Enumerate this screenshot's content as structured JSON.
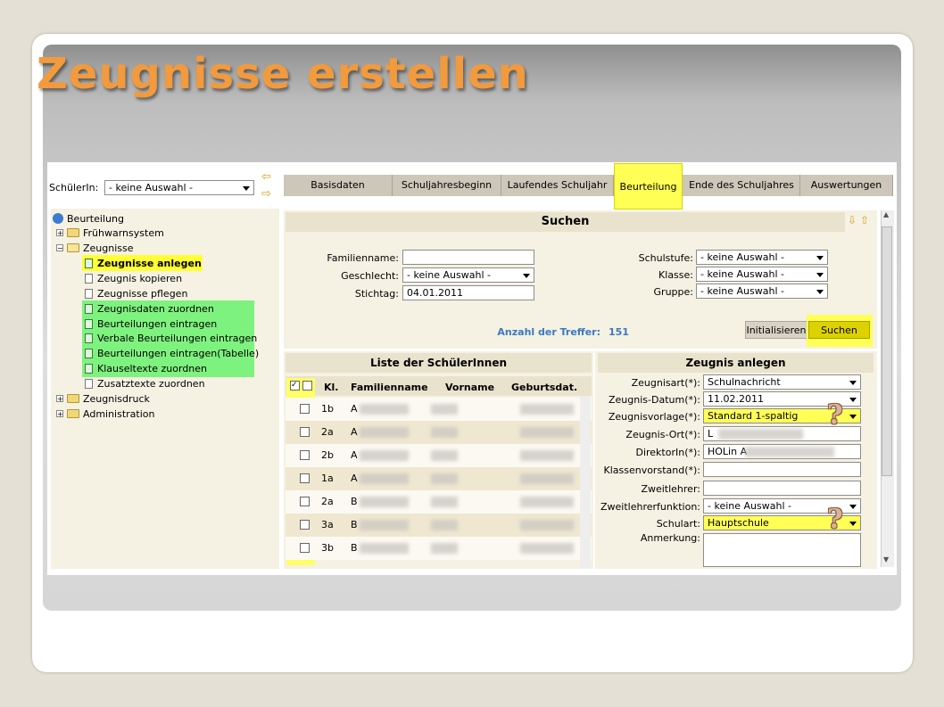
{
  "slide_title": "Zeugnisse erstellen",
  "student_select": {
    "label": "SchülerIn:",
    "value": "- keine Auswahl -"
  },
  "tabs": [
    "Basisdaten",
    "Schuljahresbeginn",
    "Laufendes Schuljahr",
    "Beurteilung",
    "Ende des Schuljahres",
    "Auswertungen"
  ],
  "active_tab": "Beurteilung",
  "tree": {
    "root": "Beurteilung",
    "nodes": [
      "Frühwarnsystem",
      "Zeugnisse",
      "Zeugnisdruck",
      "Administration"
    ],
    "zeugnisse_children": [
      "Zeugnisse anlegen",
      "Zeugnis kopieren",
      "Zeugnisse pflegen",
      "Zeugnisdaten zuordnen",
      "Beurteilungen eintragen",
      "Verbale Beurteilungen eintragen",
      "Beurteilungen eintragen(Tabelle)",
      "Klauseltexte zuordnen",
      "Zusatztexte zuordnen"
    ]
  },
  "search": {
    "header": "Suchen",
    "familienname_label": "Familienname:",
    "familienname_value": "",
    "geschlecht_label": "Geschlecht:",
    "geschlecht_value": "- keine Auswahl -",
    "stichtag_label": "Stichtag:",
    "stichtag_value": "04.01.2011",
    "schulstufe_label": "Schulstufe:",
    "schulstufe_value": "- keine Auswahl -",
    "klasse_label": "Klasse:",
    "klasse_value": "- keine Auswahl -",
    "gruppe_label": "Gruppe:",
    "gruppe_value": "- keine Auswahl -",
    "treffer_label": "Anzahl der Treffer:",
    "treffer_value": "151",
    "init_button": "Initialisieren",
    "search_button": "Suchen"
  },
  "student_list": {
    "header": "Liste der SchülerInnen",
    "columns": [
      "Kl.",
      "Familienname",
      "Vorname",
      "Geburtsdat."
    ],
    "rows": [
      {
        "kl": "1b",
        "initial": "A"
      },
      {
        "kl": "2a",
        "initial": "A"
      },
      {
        "kl": "2b",
        "initial": "A"
      },
      {
        "kl": "1a",
        "initial": "A"
      },
      {
        "kl": "2a",
        "initial": "B"
      },
      {
        "kl": "3a",
        "initial": "B"
      },
      {
        "kl": "3b",
        "initial": "B"
      }
    ]
  },
  "zeugnis": {
    "header": "Zeugnis anlegen",
    "zeugnisart_label": "Zeugnisart(*):",
    "zeugnisart_value": "Schulnachricht",
    "datum_label": "Zeugnis-Datum(*):",
    "datum_value": "11.02.2011",
    "vorlage_label": "Zeugnisvorlage(*):",
    "vorlage_value": "Standard 1-spaltig",
    "ort_label": "Zeugnis-Ort(*):",
    "ort_value": "L",
    "direktor_label": "DirektorIn(*):",
    "direktor_value": "HOLin A",
    "klassenvorstand_label": "Klassenvorstand(*):",
    "zweitlehrer_label": "Zweitlehrer:",
    "zweitlehrerfunktion_label": "Zweitlehrerfunktion:",
    "zweitlehrerfunktion_value": "- keine Auswahl -",
    "schulart_label": "Schulart:",
    "schulart_value": "Hauptschule",
    "anmerkung_label": "Anmerkung:"
  },
  "annotation_mark": "?"
}
